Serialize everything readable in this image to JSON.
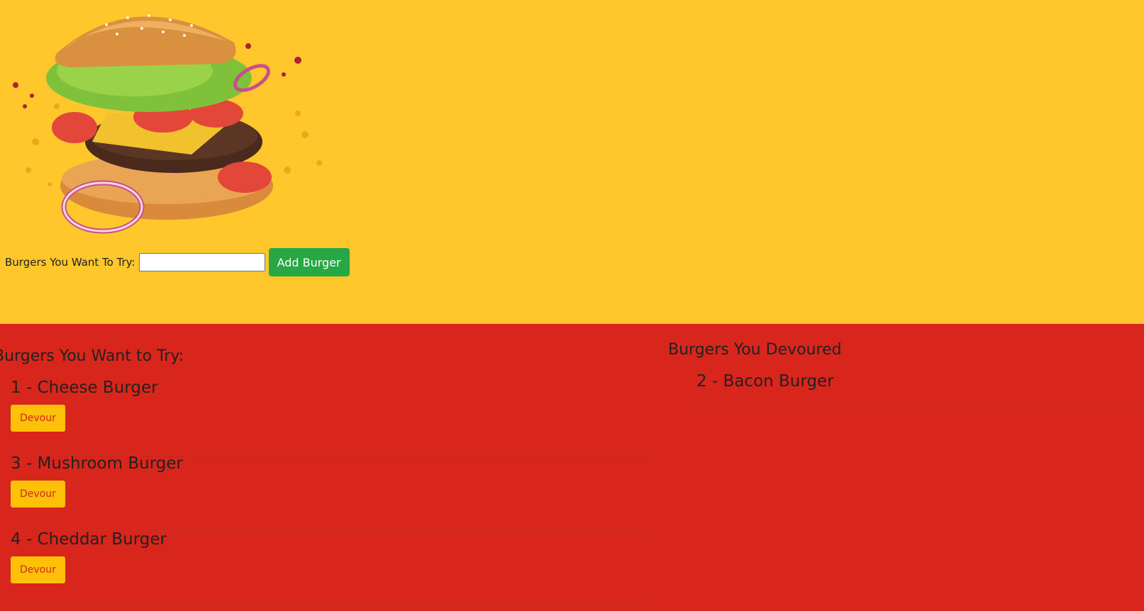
{
  "form": {
    "label": "Burgers You Want To Try:",
    "input_value": "",
    "input_placeholder": "",
    "add_button": "Add Burger"
  },
  "want": {
    "heading": "Burgers You Want to Try:",
    "items": [
      {
        "title": "1 - Cheese Burger",
        "button": "Devour"
      },
      {
        "title": "3 - Mushroom Burger",
        "button": "Devour"
      },
      {
        "title": "4 - Cheddar Burger",
        "button": "Devour"
      }
    ]
  },
  "devoured": {
    "heading": "Burgers You Devoured",
    "items": [
      {
        "title": "2 - Bacon Burger"
      }
    ]
  },
  "colors": {
    "top_background": "#ffc72c",
    "bottom_background": "#d9261c",
    "add_button": "#28a745",
    "devour_button": "#ffc107"
  }
}
